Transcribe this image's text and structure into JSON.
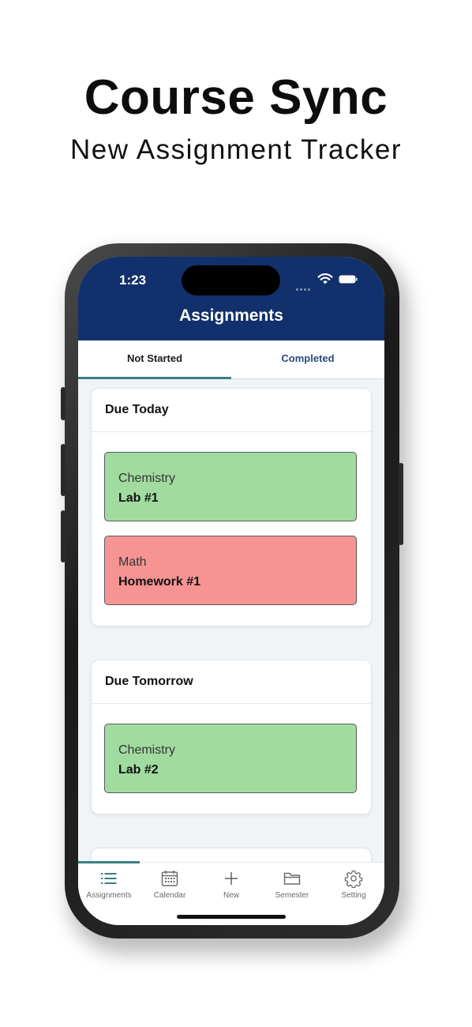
{
  "hero": {
    "title": "Course Sync",
    "subtitle": "New Assignment Tracker"
  },
  "status_bar": {
    "time": "1:23",
    "icons": [
      "signal-dots-icon",
      "wifi-icon",
      "battery-icon"
    ]
  },
  "header": {
    "title": "Assignments"
  },
  "tabs": [
    {
      "label": "Not Started",
      "active": true
    },
    {
      "label": "Completed",
      "active": false
    }
  ],
  "sections": [
    {
      "heading": "Due Today",
      "items": [
        {
          "course": "Chemistry",
          "title": "Lab #1",
          "color": "#a0dca0"
        },
        {
          "course": "Math",
          "title": "Homework #1",
          "color": "#f69494"
        }
      ]
    },
    {
      "heading": "Due Tomorrow",
      "items": [
        {
          "course": "Chemistry",
          "title": "Lab #2",
          "color": "#a0dca0"
        }
      ]
    }
  ],
  "bottom_nav": [
    {
      "label": "Assignments",
      "icon": "list-icon",
      "active": true
    },
    {
      "label": "Calendar",
      "icon": "calendar-icon",
      "active": false
    },
    {
      "label": "New",
      "icon": "plus-icon",
      "active": false
    },
    {
      "label": "Semester",
      "icon": "folder-icon",
      "active": false
    },
    {
      "label": "Setting",
      "icon": "gear-icon",
      "active": false
    }
  ],
  "colors": {
    "header_bg": "#12306b",
    "accent": "#3b7f86",
    "completed_tab": "#284b7a"
  }
}
